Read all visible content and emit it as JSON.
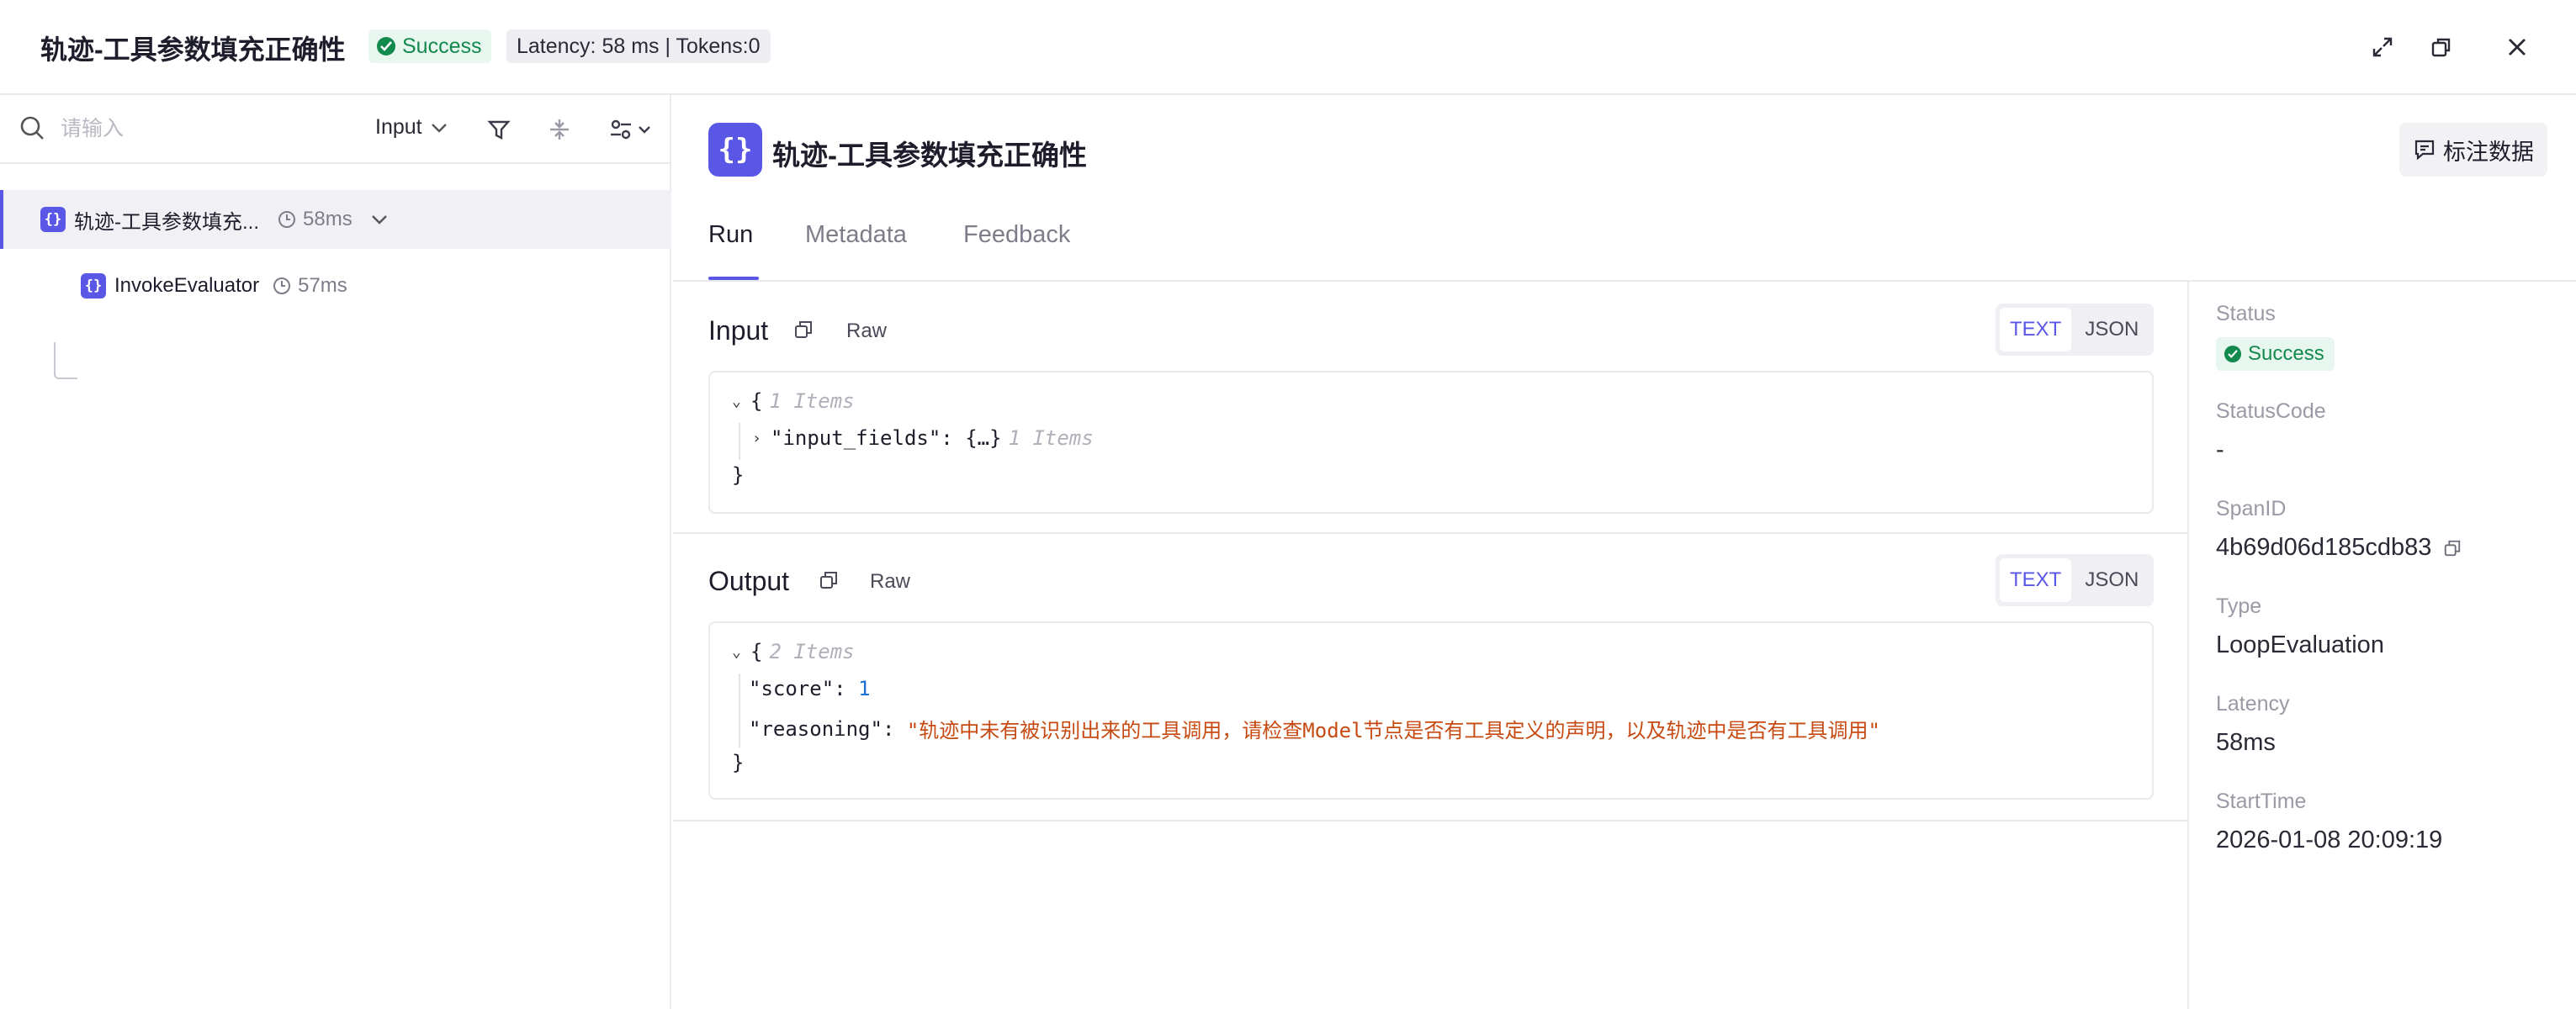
{
  "header": {
    "title": "轨迹-工具参数填充正确性",
    "status_badge": "Success",
    "latency_badge": "Latency: 58 ms | Tokens:0"
  },
  "left_panel": {
    "search_placeholder": "请输入",
    "filter_select": "Input",
    "tree": [
      {
        "label": "轨迹-工具参数填充...",
        "time": "58ms",
        "selected": true
      },
      {
        "label": "InvokeEvaluator",
        "time": "57ms",
        "selected": false
      }
    ]
  },
  "main": {
    "title": "轨迹-工具参数填充正确性",
    "annotate_button": "标注数据",
    "tabs": [
      "Run",
      "Metadata",
      "Feedback"
    ],
    "active_tab": "Run",
    "input": {
      "title": "Input",
      "raw": "Raw",
      "mode_text": "TEXT",
      "mode_json": "JSON",
      "root_count": "1 Items",
      "key": "\"input_fields\"",
      "collapsed_value": "{…}",
      "child_count": "1 Items"
    },
    "output": {
      "title": "Output",
      "raw": "Raw",
      "mode_text": "TEXT",
      "mode_json": "JSON",
      "root_count": "2 Items",
      "score_key": "\"score\"",
      "score_value": "1",
      "reasoning_key": "\"reasoning\"",
      "reasoning_value": "\"轨迹中未有被识别出来的工具调用，请检查Model节点是否有工具定义的声明，以及轨迹中是否有工具调用\""
    }
  },
  "details": {
    "status_label": "Status",
    "status_value": "Success",
    "status_code_label": "StatusCode",
    "status_code_value": "-",
    "span_id_label": "SpanID",
    "span_id_value": "4b69d06d185cdb83",
    "type_label": "Type",
    "type_value": "LoopEvaluation",
    "latency_label": "Latency",
    "latency_value": "58ms",
    "start_time_label": "StartTime",
    "start_time_value": "2026-01-08 20:09:19"
  },
  "colors": {
    "accent": "#5a57e6",
    "success": "#12894d",
    "string": "#c64a12",
    "number": "#1a6fd6"
  }
}
